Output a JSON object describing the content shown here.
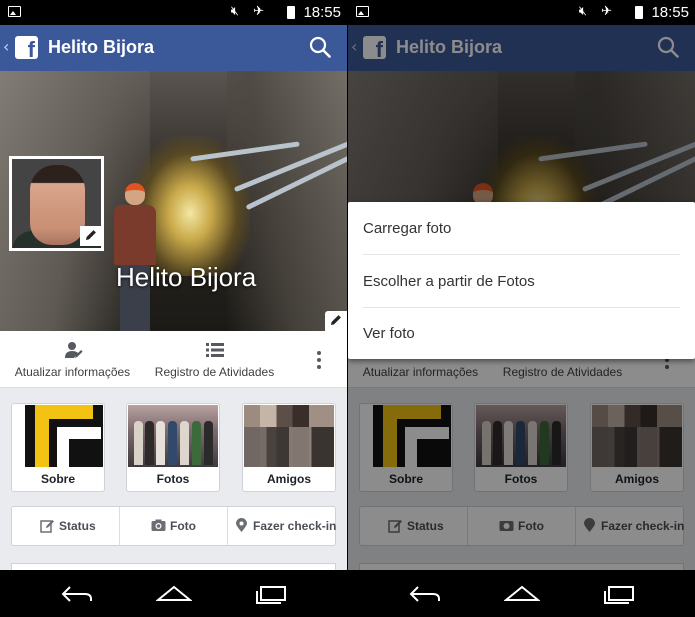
{
  "status_bar": {
    "time": "18:55"
  },
  "app_bar": {
    "title": "Helito Bijora",
    "logo_letter": "f"
  },
  "cover": {
    "name": "Helito Bijora"
  },
  "actions": {
    "update_info": "Atualizar informações",
    "activity_log": "Registro de Atividades"
  },
  "tiles": [
    {
      "label": "Sobre"
    },
    {
      "label": "Fotos"
    },
    {
      "label": "Amigos"
    }
  ],
  "composer": {
    "status": "Status",
    "photo": "Foto",
    "checkin": "Fazer check-in"
  },
  "menu": {
    "items": [
      {
        "label": "Carregar foto"
      },
      {
        "label": "Escolher a partir de Fotos"
      },
      {
        "label": "Ver foto"
      }
    ]
  },
  "colors": {
    "brand": "#3b5998",
    "background": "#e9ebee",
    "statusbar": "#000000"
  },
  "icons": [
    "image-icon",
    "mute-icon",
    "wifi-icon",
    "airplane-icon",
    "battery-icon",
    "search-icon",
    "facebook-logo-icon",
    "pencil-icon",
    "person-edit-icon",
    "list-icon",
    "more-vertical-icon",
    "status-edit-icon",
    "camera-icon",
    "location-pin-icon",
    "back-nav-icon",
    "home-nav-icon",
    "recents-nav-icon"
  ]
}
